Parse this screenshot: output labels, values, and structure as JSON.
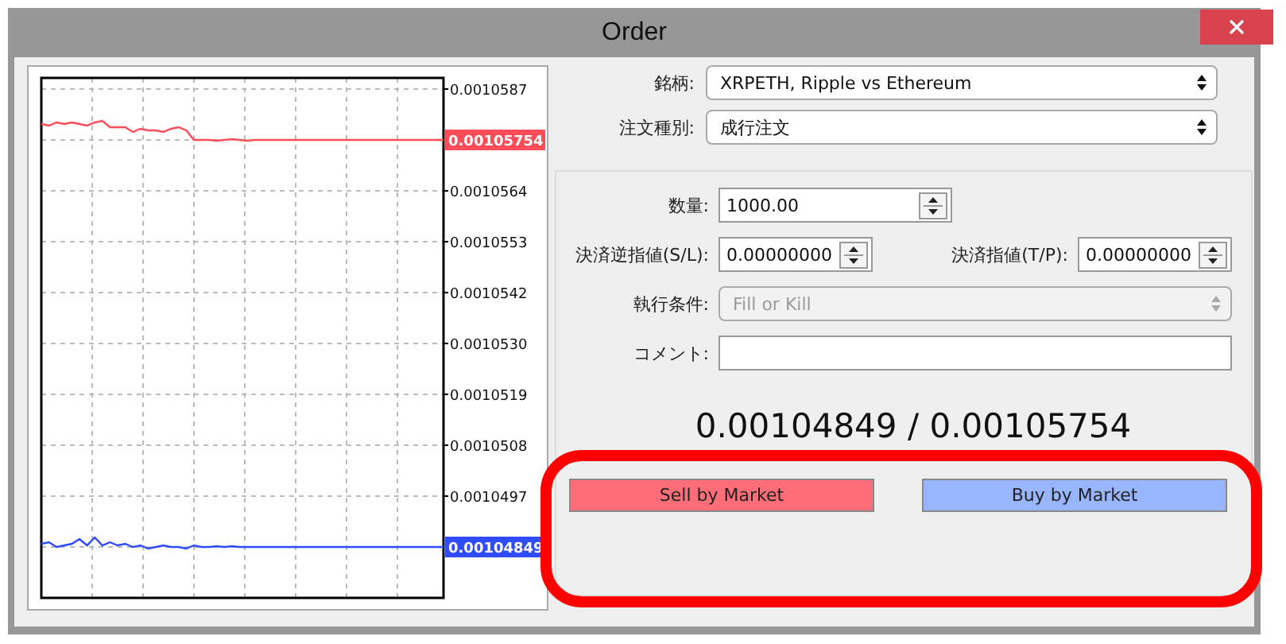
{
  "window": {
    "title": "Order"
  },
  "chart": {
    "axis_labels": [
      "0.0010587",
      "0.0010564",
      "0.0010553",
      "0.0010542",
      "0.0010530",
      "0.0010519",
      "0.0010508",
      "0.0010497"
    ],
    "price_tags": [
      {
        "text": "0.00105754",
        "color": "#ff4d58"
      },
      {
        "text": "0.00104849",
        "color": "#2f4dff"
      }
    ]
  },
  "symbol": {
    "label": "銘柄:",
    "value": "XRPETH, Ripple vs Ethereum"
  },
  "order_type": {
    "label": "注文種別:",
    "value": "成行注文"
  },
  "volume": {
    "label": "数量:",
    "value": "1000.00"
  },
  "stop_loss": {
    "label": "決済逆指値(S/L):",
    "value": "0.00000000"
  },
  "take_profit": {
    "label": "決済指値(T/P):",
    "value": "0.00000000"
  },
  "fill_policy": {
    "label": "執行条件:",
    "value": "Fill or Kill",
    "disabled": true
  },
  "comment": {
    "label": "コメント:"
  },
  "quote": "0.00104849 / 0.00105754",
  "buttons": [
    {
      "label": "Sell by Market",
      "kind": "sell"
    },
    {
      "label": "Buy by Market",
      "kind": "buy"
    }
  ],
  "highlight_buttons": true
}
